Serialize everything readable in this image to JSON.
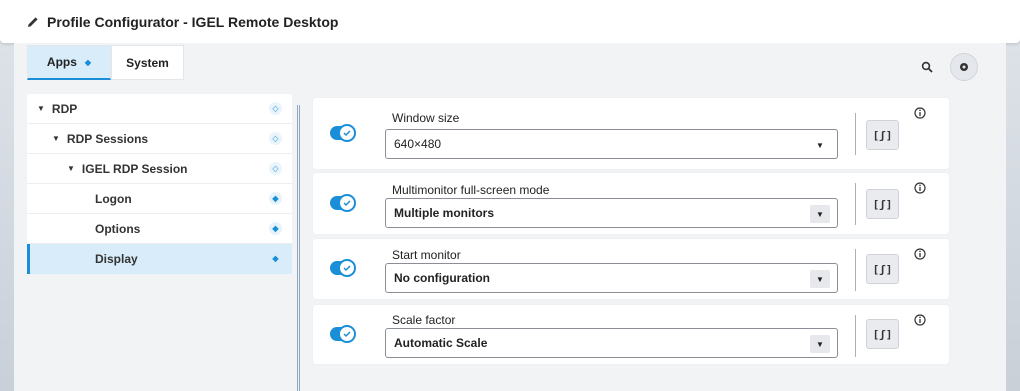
{
  "window": {
    "title": "Profile Configurator  - IGEL Remote Desktop"
  },
  "tabs": [
    {
      "label": "Apps",
      "active": true
    },
    {
      "label": "System",
      "active": false
    }
  ],
  "tree": [
    {
      "label": "RDP",
      "level": 0,
      "expandable": true
    },
    {
      "label": "RDP Sessions",
      "level": 1,
      "expandable": true
    },
    {
      "label": "IGEL RDP Session",
      "level": 2,
      "expandable": true
    },
    {
      "label": "Logon",
      "level": 3,
      "expandable": false
    },
    {
      "label": "Options",
      "level": 3,
      "expandable": false
    },
    {
      "label": "Display",
      "level": 3,
      "expandable": false,
      "selected": true
    }
  ],
  "settings": [
    {
      "label": "Window size",
      "value": "640×480",
      "enabled": true,
      "script_label": "[ʃ]"
    },
    {
      "label": "Multimonitor full-screen mode",
      "value": "Multiple monitors",
      "enabled": true,
      "script_label": "[ʃ]"
    },
    {
      "label": "Start monitor",
      "value": "No configuration",
      "enabled": true,
      "script_label": "[ʃ]"
    },
    {
      "label": "Scale factor",
      "value": "Automatic Scale",
      "enabled": true,
      "script_label": "[ʃ]"
    }
  ],
  "colors": {
    "accent": "#1a8fd8",
    "selected_bg": "#d8edf9"
  }
}
